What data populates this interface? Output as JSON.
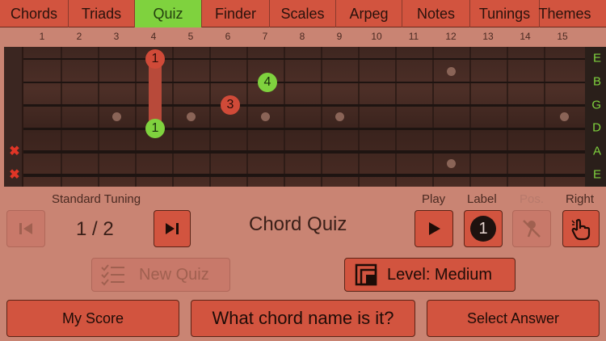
{
  "tabs": [
    {
      "label": "Chords",
      "active": false
    },
    {
      "label": "Triads",
      "active": false
    },
    {
      "label": "Quiz",
      "active": true
    },
    {
      "label": "Finder",
      "active": false
    },
    {
      "label": "Scales",
      "active": false
    },
    {
      "label": "Arpeg",
      "active": false
    },
    {
      "label": "Notes",
      "active": false
    },
    {
      "label": "Tunings",
      "active": false
    },
    {
      "label": "Themes",
      "active": false
    }
  ],
  "fret_numbers": [
    "1",
    "2",
    "3",
    "4",
    "5",
    "6",
    "7",
    "8",
    "9",
    "10",
    "11",
    "12",
    "13",
    "14",
    "15"
  ],
  "string_names": [
    "E",
    "B",
    "G",
    "D",
    "A",
    "E"
  ],
  "finger_markers": [
    {
      "label": "1",
      "color": "red"
    },
    {
      "label": "4",
      "color": "green"
    },
    {
      "label": "3",
      "color": "red"
    },
    {
      "label": "1",
      "color": "green"
    }
  ],
  "muted_marker": "✖",
  "tuning": {
    "label": "Standard Tuning",
    "position": "1 / 2"
  },
  "title": "Chord Quiz",
  "controls": {
    "play_label": "Play",
    "label_label": "Label",
    "label_value": "1",
    "pos_label": "Pos.",
    "right_label": "Right"
  },
  "new_quiz": "New Quiz",
  "level": "Level: Medium",
  "bottom": {
    "my_score": "My Score",
    "question": "What chord name is it?",
    "select_answer": "Select Answer"
  },
  "colors": {
    "accent": "#d2543f",
    "active_tab": "#7fd23e",
    "background": "#c98473"
  }
}
